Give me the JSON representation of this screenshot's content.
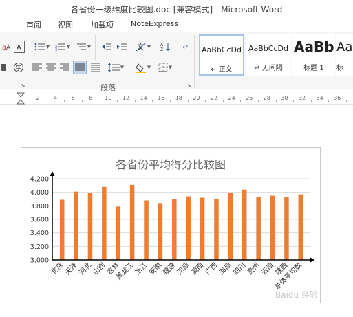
{
  "window": {
    "title": "各省份一级维度比较图.doc [兼容模式] - Microsoft Word"
  },
  "menu": {
    "items": [
      "审阅",
      "视图",
      "加载项",
      "NoteExpress"
    ]
  },
  "ribbon": {
    "paragraph_label": "段落",
    "styles": [
      {
        "preview": "AaBbCcDd",
        "name": "↵ 正文",
        "selected": true
      },
      {
        "preview": "AaBbCcDd",
        "name": "↵ 无间隔",
        "selected": false
      },
      {
        "preview": "AaBb",
        "name": "标题 1",
        "selected": false
      },
      {
        "preview": "Aa",
        "name": "标",
        "selected": false
      }
    ]
  },
  "ruler": {
    "numbers": [
      "2",
      "4",
      "6",
      "8",
      "10",
      "12",
      "14",
      "16",
      "18",
      "20",
      "22",
      "24",
      "26",
      "28",
      "30",
      "32",
      "34",
      "36"
    ]
  },
  "colors": {
    "bar": "#ED7D31",
    "accent": "#2B579A"
  },
  "chart_data": {
    "type": "bar",
    "title": "各省份平均得分比较图",
    "categories": [
      "北京",
      "天津",
      "河北",
      "山西",
      "吉林",
      "黑龙江",
      "浙江",
      "安徽",
      "福建",
      "河南",
      "湖南",
      "广西",
      "海南",
      "四川",
      "贵州",
      "云南",
      "陕西",
      "总体平均数"
    ],
    "values": [
      3.89,
      4.01,
      3.99,
      4.08,
      3.79,
      4.11,
      3.88,
      3.84,
      3.9,
      3.94,
      3.92,
      3.9,
      3.99,
      4.04,
      3.93,
      3.95,
      3.93,
      3.97
    ],
    "ylim": [
      3.0,
      4.2
    ],
    "yticks": [
      "3.000",
      "3.200",
      "3.400",
      "3.600",
      "3.800",
      "4.000",
      "4.200"
    ],
    "grid": true,
    "legend": "none"
  },
  "watermark": "Baidu 经验"
}
